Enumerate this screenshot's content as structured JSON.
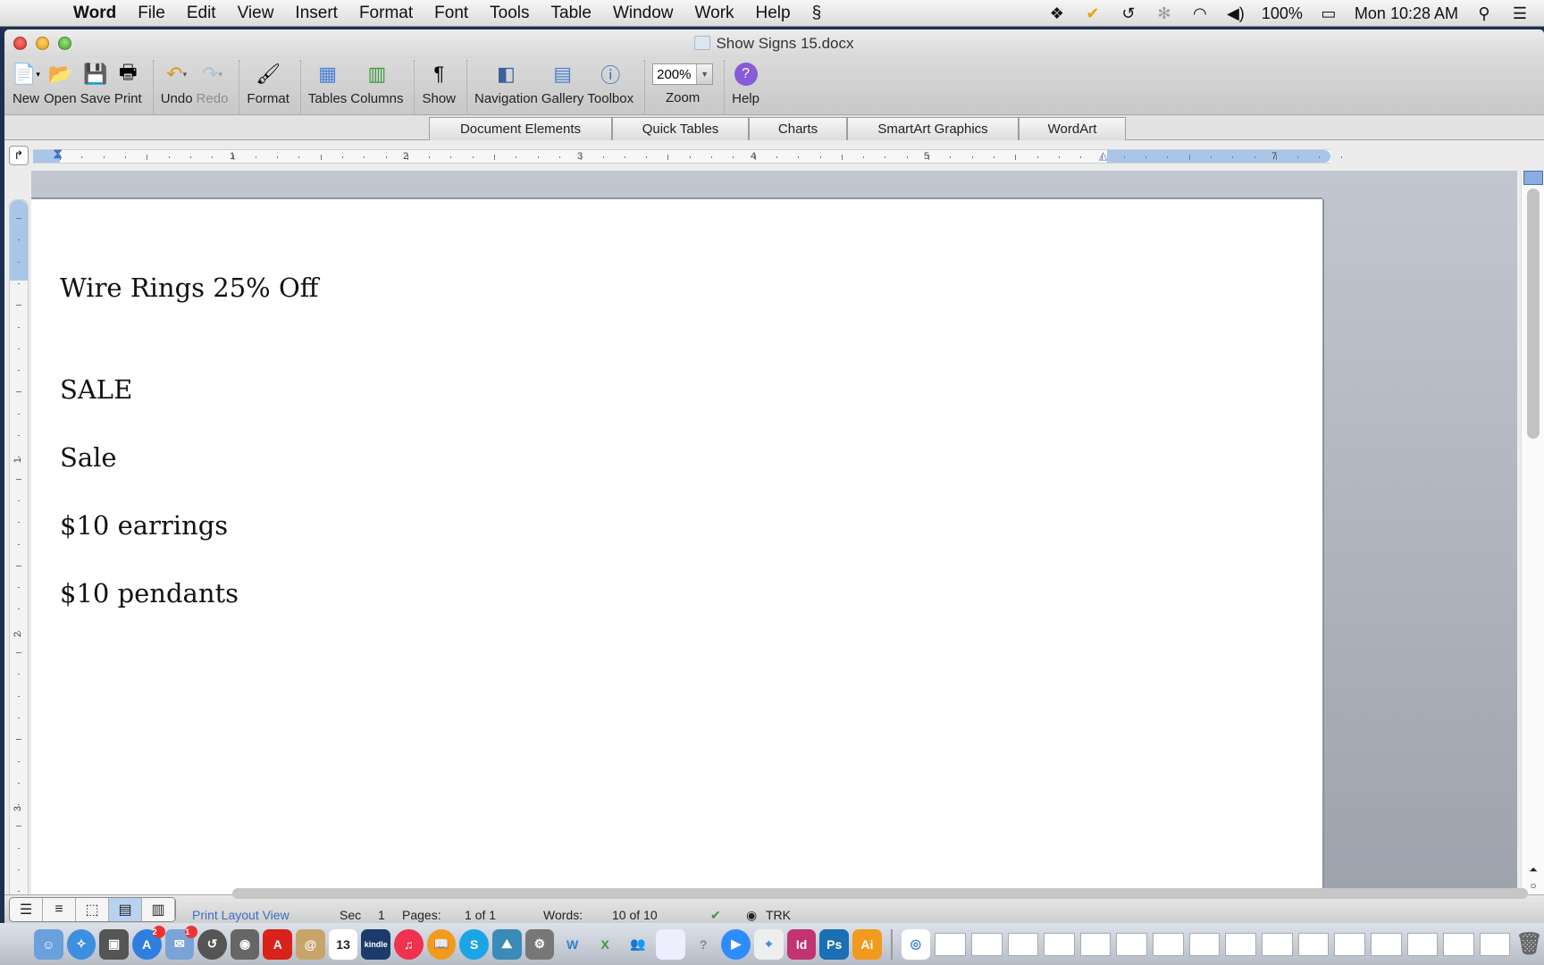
{
  "menubar": {
    "app_name": "Word",
    "items": [
      "File",
      "Edit",
      "View",
      "Insert",
      "Format",
      "Font",
      "Tools",
      "Table",
      "Window",
      "Work",
      "Help"
    ],
    "battery": "100%",
    "clock": "Mon 10:28 AM",
    "tray_icons": [
      "dropbox-icon",
      "norton-check-icon",
      "time-machine-icon",
      "bluetooth-icon",
      "wifi-icon",
      "volume-icon",
      "battery-icon",
      "spotlight-icon",
      "notification-center-icon"
    ]
  },
  "window": {
    "title": "Show Signs 15.docx"
  },
  "toolbar": {
    "new": "New",
    "open": "Open",
    "save": "Save",
    "print": "Print",
    "undo": "Undo",
    "redo": "Redo",
    "format": "Format",
    "tables": "Tables",
    "columns": "Columns",
    "show": "Show",
    "navigation": "Navigation",
    "gallery": "Gallery",
    "toolbox": "Toolbox",
    "zoom_label": "Zoom",
    "zoom_value": "200%",
    "help": "Help"
  },
  "ribbon": {
    "tabs": [
      "Document Elements",
      "Quick Tables",
      "Charts",
      "SmartArt Graphics",
      "WordArt"
    ]
  },
  "ruler": {
    "numbers": [
      "1",
      "2",
      "3",
      "4",
      "5",
      "7"
    ],
    "vnumbers": [
      "1",
      "2",
      "3"
    ]
  },
  "document": {
    "lines": [
      "Wire Rings 25% Off",
      "SALE",
      "Sale",
      "$10 earrings",
      "$10 pendants"
    ]
  },
  "statusbar": {
    "view_name": "Print Layout View",
    "sec_label": "Sec",
    "sec_value": "1",
    "pages_label": "Pages:",
    "pages_value": "1 of 1",
    "words_label": "Words:",
    "words_value": "10 of 10",
    "trk": "TRK"
  },
  "dock": {
    "apps": [
      "Finder",
      "Safari",
      "iPhoto",
      "App Store",
      "Mail",
      "Time Machine",
      "FaceTime",
      "Acrobat",
      "Contacts",
      "Calendar",
      "Kindle",
      "iTunes",
      "iBooks",
      "Skype",
      "Preview",
      "System Preferences",
      "Word",
      "Excel",
      "Messenger",
      "Lync",
      "Help",
      "Zoom",
      "Maps",
      "InDesign",
      "Photoshop",
      "Illustrator"
    ],
    "calendar_day": "13",
    "kindle_label": "kindle",
    "badges": {
      "app_store": "2",
      "mail": "1"
    }
  }
}
